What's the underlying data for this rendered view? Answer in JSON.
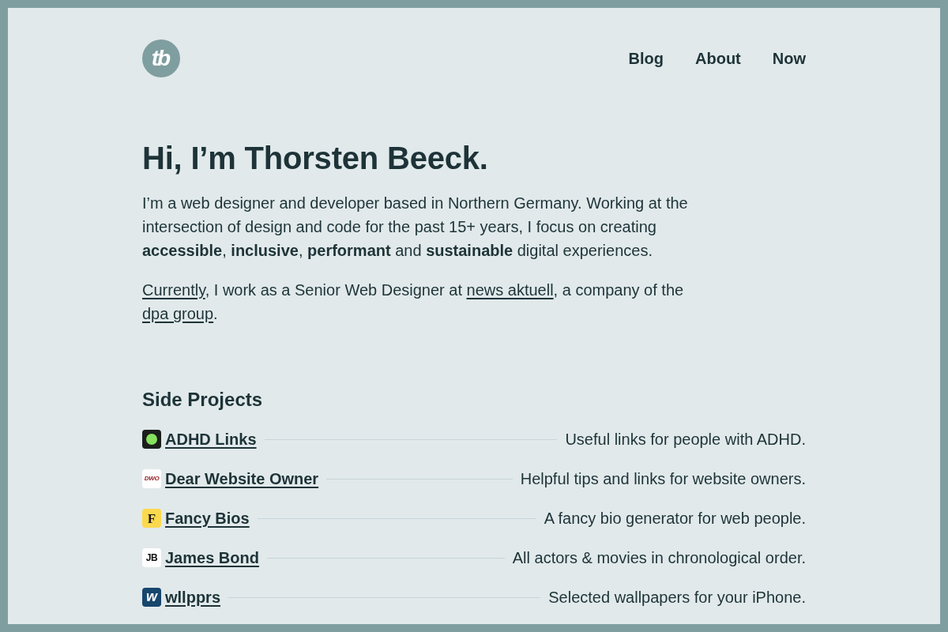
{
  "header": {
    "logo": "tb",
    "nav": [
      "Blog",
      "About",
      "Now"
    ]
  },
  "intro": {
    "heading": "Hi, I’m Thorsten Beeck.",
    "paragraph": "I’m a web designer and developer based in Northern Germany. Working at the intersection of design and code for the past 15+ years, I focus on creating **accessible**, **inclusive**, **performant** and **sustainable** digital experiences.",
    "current": [
      {
        "kind": "link",
        "text": "Currently"
      },
      {
        "kind": "text",
        "text": ", I work as a Senior Web Designer at "
      },
      {
        "kind": "link",
        "text": "news aktuell"
      },
      {
        "kind": "text",
        "text": ", a company of the "
      },
      {
        "kind": "link",
        "text": "dpa group"
      },
      {
        "kind": "text",
        "text": "."
      }
    ]
  },
  "side_projects": {
    "heading": "Side Projects",
    "items": [
      {
        "name": "ADHD Links",
        "description": "Useful links for people with ADHD.",
        "kind": "dot"
      },
      {
        "name": "Dear Website Owner",
        "description": "Helpful tips and links for website owners.",
        "kind": "wordmark",
        "logo_text": "DWO"
      },
      {
        "name": "Fancy Bios",
        "description": "A fancy bio generator for web people.",
        "kind": "serif",
        "logo_text": "F"
      },
      {
        "name": "James Bond",
        "description": "All actors & movies in chronological order.",
        "kind": "monogram",
        "logo_text": "JB"
      },
      {
        "name": "wllpprs",
        "description": "Selected wallpapers for your iPhone.",
        "kind": "script",
        "logo_text": "w"
      }
    ]
  }
}
